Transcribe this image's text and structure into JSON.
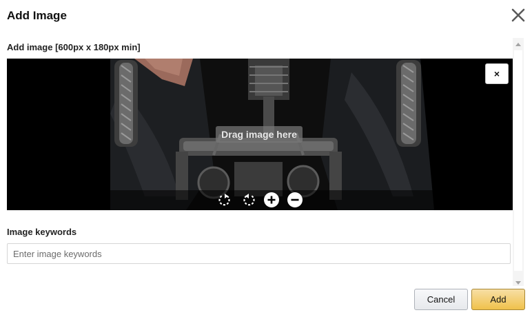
{
  "dialog": {
    "title": "Add Image",
    "close_icon": "close-icon"
  },
  "image_section": {
    "label": "Add image [600px x 180px min]",
    "drag_hint": "Drag image here",
    "remove_label": "×",
    "tools": [
      {
        "name": "rotate-right-icon"
      },
      {
        "name": "rotate-left-icon"
      },
      {
        "name": "zoom-in-icon"
      },
      {
        "name": "zoom-out-icon"
      }
    ]
  },
  "keywords": {
    "label": "Image keywords",
    "placeholder": "Enter image keywords",
    "value": ""
  },
  "footer": {
    "cancel_label": "Cancel",
    "add_label": "Add"
  },
  "colors": {
    "add_button": "#f0c14b",
    "cancel_button": "#e7e9ec",
    "image_background": "#000000"
  }
}
